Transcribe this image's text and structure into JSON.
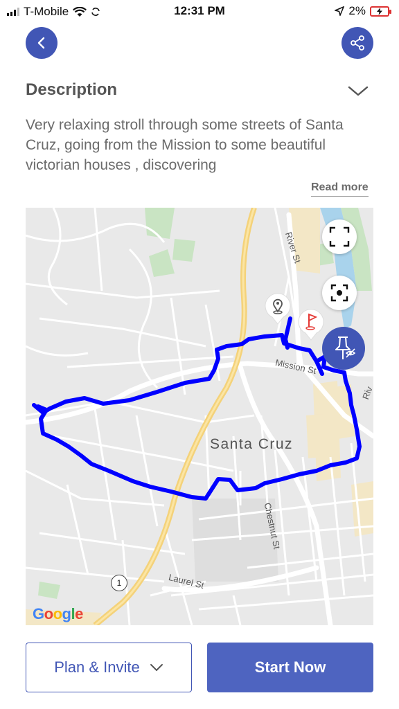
{
  "status_bar": {
    "carrier": "T-Mobile",
    "time": "12:31 PM",
    "battery": "2%"
  },
  "header": {
    "back_icon": "chevron-left-icon",
    "share_icon": "share-icon"
  },
  "description": {
    "title": "Description",
    "text": "Very relaxing stroll through some streets of Santa Cruz, going from the Mission to some beautiful victorian houses , discovering",
    "read_more": "Read more"
  },
  "map": {
    "city_label": "Santa Cruz",
    "streets": {
      "river": "River St",
      "mission": "Mission St",
      "chestnut": "Chestnut St",
      "laurel": "Laurel St",
      "river_partial": "Riv"
    },
    "highway_shield": "1",
    "attribution": [
      "G",
      "o",
      "o",
      "g",
      "l",
      "e"
    ],
    "route_color": "#0000ff",
    "accent_color": "#4156b5"
  },
  "actions": {
    "plan_invite": "Plan & Invite",
    "start_now": "Start Now"
  }
}
